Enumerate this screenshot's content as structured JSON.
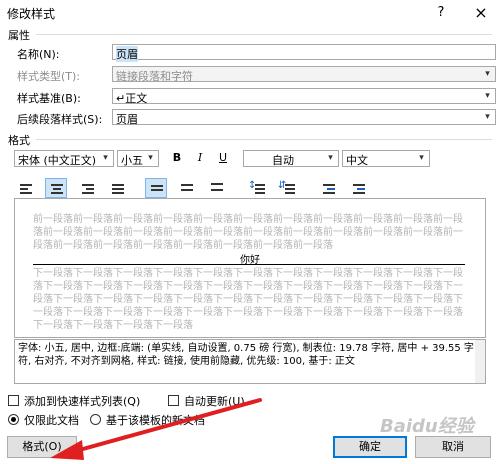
{
  "window": {
    "title": "修改样式",
    "help": "?",
    "close": "×"
  },
  "properties": {
    "section": "属性",
    "name_label": "名称(N):",
    "name_value": "页眉",
    "type_label": "样式类型(T):",
    "type_value": "链接段落和字符",
    "based_label": "样式基准(B):",
    "based_value": "↵正文",
    "next_label": "后续段落样式(S):",
    "next_value": "页眉"
  },
  "format": {
    "section": "格式",
    "font": "宋体 (中文正文)",
    "size": "小五",
    "bold": "B",
    "italic": "I",
    "underline": "U",
    "color": "自动",
    "language": "中文"
  },
  "preview": {
    "before": "前一段落前一段落前一段落前一段落前一段落前一段落前一段落前一段落前一段落前一段落前一段落前一段落前一段落前一段落前一段落前一段落前一段落前一段落前一段落前一段落前一段落前一段落前一段落前一段落前一段落前一段落前一段落前一段落前一段落",
    "sample": "你好",
    "after": "下一段落下一段落下一段落下一段落下一段落下一段落下一段落下一段落下一段落下一段落下一段落下一段落下一段落下一段落下一段落下一段落下一段落下一段落下一段落下一段落下一段落下一段落下一段落下一段落下一段落下一段落下一段落下一段落下一段落下一段落下一段落下一段落下一段落下一段落下一段落下一段落下一段落下一段落下一段落下一段落下一段落下一段落下一段落下一段落下一段落下一段落下一段落"
  },
  "description": "字体: 小五, 居中, 边框:底端: (单实线, 自动设置, 0.75 磅 行宽), 制表位: 19.78 字符, 居中 + 39.55 字符, 右对齐, 不对齐到网格, 样式: 链接, 使用前隐藏, 优先级: 100, 基于: 正文",
  "options": {
    "add_gallery": "添加到快速样式列表(Q)",
    "auto_update": "自动更新(U)",
    "only_doc": "仅限此文档",
    "new_template": "基于该模板的新文档"
  },
  "buttons": {
    "format": "格式(O)",
    "ok": "确定",
    "cancel": "取消"
  },
  "watermark": "Baidu经验",
  "colors": {
    "accent": "#0078d7",
    "arrow": "#e02020",
    "selection": "#cce4f7"
  }
}
